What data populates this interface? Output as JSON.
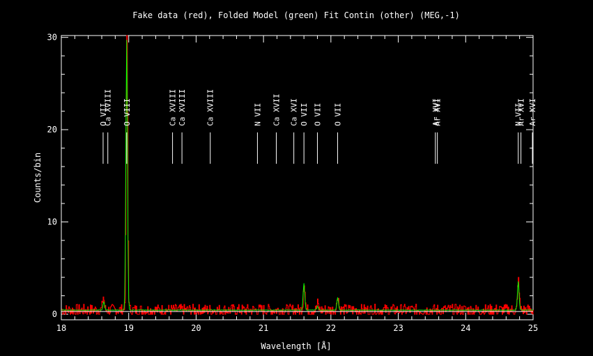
{
  "chart_data": {
    "type": "line",
    "title": "Fake data (red), Folded Model (green) Fit Contin (other) (MEG,-1)",
    "xlabel": "Wavelength [Å]",
    "ylabel": "Counts/bin",
    "xlim": [
      18,
      25
    ],
    "ylim": [
      -0.6,
      30.2
    ],
    "x_ticks": [
      "18",
      "19",
      "20",
      "21",
      "22",
      "23",
      "24",
      "25"
    ],
    "y_ticks": [
      "0",
      "10",
      "20",
      "30"
    ],
    "grid": false,
    "series": [
      {
        "color": "#ff0000",
        "style": "histogram",
        "continuum": 0.45,
        "noise": 1.0,
        "peaks": [
          [
            18.62,
            1.5
          ],
          [
            18.97,
            30.2
          ],
          [
            21.6,
            3.2
          ],
          [
            21.8,
            0.7
          ],
          [
            22.1,
            1.8
          ],
          [
            24.78,
            3.3
          ]
        ]
      },
      {
        "color": "#00ff00",
        "style": "line",
        "continuum": 0.45,
        "noise": 0.05,
        "peaks": [
          [
            18.63,
            0.9
          ],
          [
            18.97,
            29.3
          ],
          [
            21.6,
            2.9
          ],
          [
            21.8,
            0.4
          ],
          [
            22.1,
            1.4
          ],
          [
            24.78,
            3.1
          ]
        ]
      },
      {
        "color": "#ffffff",
        "style": "line",
        "continuum": 0.3,
        "noise": 0.0,
        "peaks": []
      }
    ],
    "line_ids": [
      {
        "label": "O VII",
        "wavelength": 18.62
      },
      {
        "label": "Ca XVIII",
        "wavelength": 18.69
      },
      {
        "label": "O VIII",
        "wavelength": 18.97
      },
      {
        "label": "Ca XVIII",
        "wavelength": 19.65
      },
      {
        "label": "Ca XVIII",
        "wavelength": 19.79
      },
      {
        "label": "Ca XVIII",
        "wavelength": 20.21
      },
      {
        "label": "N VII",
        "wavelength": 20.91
      },
      {
        "label": "Ca XVII",
        "wavelength": 21.19
      },
      {
        "label": "Ca XVI",
        "wavelength": 21.45
      },
      {
        "label": "O VII",
        "wavelength": 21.6
      },
      {
        "label": "O VII",
        "wavelength": 21.8
      },
      {
        "label": "O VII",
        "wavelength": 22.1
      },
      {
        "label": "Ar XVI",
        "wavelength": 23.55
      },
      {
        "label": "Ar XVI",
        "wavelength": 23.58
      },
      {
        "label": "N VII",
        "wavelength": 24.78
      },
      {
        "label": "Ar XVI",
        "wavelength": 24.82
      },
      {
        "label": "Ar XVI",
        "wavelength": 24.99
      }
    ]
  }
}
